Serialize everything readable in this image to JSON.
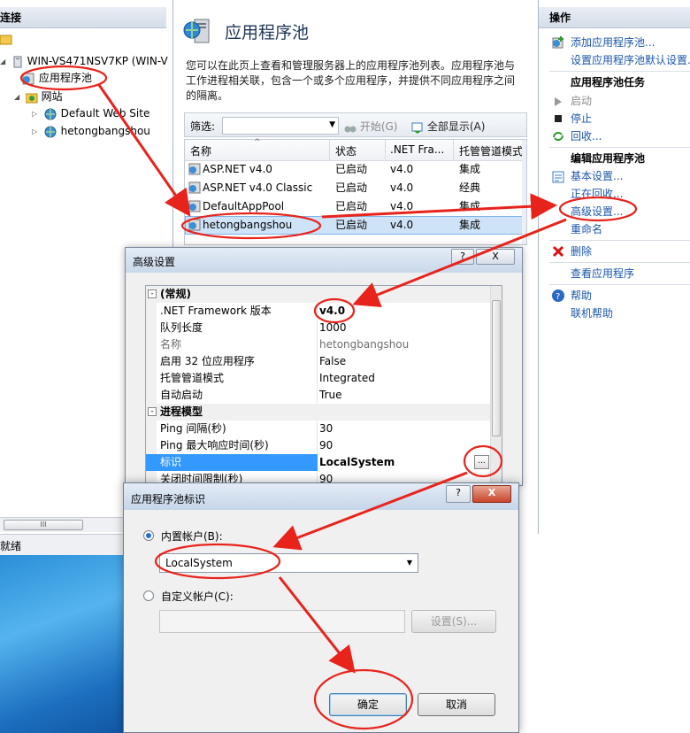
{
  "connections": {
    "header": "连接",
    "server": "WIN-VS471NSV7KP (WIN-V",
    "app_pools": "应用程序池",
    "sites": "网站",
    "site1": "Default Web Site",
    "site2": "hetongbangshou",
    "scroll_grip": "III",
    "status": "就绪"
  },
  "features": {
    "title": "应用程序池",
    "description": "您可以在此页上查看和管理服务器上的应用程序池列表。应用程序池与工作进程相关联，包含一个或多个应用程序，并提供不同应用程序之间的隔离。",
    "filter_label": "筛选:",
    "start_label": "开始(G)",
    "show_all_label": "全部显示(A)",
    "columns": [
      "名称",
      "状态",
      ".NET Fra...",
      "托管管道模式"
    ],
    "rows": [
      {
        "name": "ASP.NET v4.0",
        "status": "已启动",
        "net": "v4.0",
        "mode": "集成"
      },
      {
        "name": "ASP.NET v4.0 Classic",
        "status": "已启动",
        "net": "v4.0",
        "mode": "经典"
      },
      {
        "name": "DefaultAppPool",
        "status": "已启动",
        "net": "v4.0",
        "mode": "集成"
      },
      {
        "name": "hetongbangshou",
        "status": "已启动",
        "net": "v4.0",
        "mode": "集成"
      }
    ]
  },
  "actions": {
    "header": "操作",
    "add_pool": "添加应用程序池...",
    "set_defaults": "设置应用程序池默认设置...",
    "tasks_header": "应用程序池任务",
    "start": "启动",
    "stop": "停止",
    "recycle": "回收...",
    "edit_header": "编辑应用程序池",
    "basic_settings": "基本设置...",
    "recycling": "正在回收...",
    "advanced_settings": "高级设置...",
    "rename": "重命名",
    "delete": "删除",
    "view_apps": "查看应用程序",
    "help": "帮助",
    "online_help": "联机帮助"
  },
  "advanced_dialog": {
    "title": "高级设置",
    "help_btn": "?",
    "close_btn": "X",
    "properties": [
      {
        "name": "(常规)",
        "value": ""
      },
      {
        "name": ".NET Framework 版本",
        "value": "v4.0"
      },
      {
        "name": "队列长度",
        "value": "1000"
      },
      {
        "name": "名称",
        "value": "hetongbangshou"
      },
      {
        "name": "启用 32 位应用程序",
        "value": "False"
      },
      {
        "name": "托管管道模式",
        "value": "Integrated"
      },
      {
        "name": "自动启动",
        "value": "True"
      },
      {
        "name": "进程模型",
        "value": ""
      },
      {
        "name": "Ping 间隔(秒)",
        "value": "30"
      },
      {
        "name": "Ping 最大响应时间(秒)",
        "value": "90"
      },
      {
        "name": "标识",
        "value": "LocalSystem"
      },
      {
        "name": "关闭时间限制(秒)",
        "value": "90"
      }
    ],
    "ellipsis": "..."
  },
  "identity_dialog": {
    "title": "应用程序池标识",
    "help_btn": "?",
    "close_btn": "X",
    "builtin_label": "内置帐户(B):",
    "builtin_value": "LocalSystem",
    "custom_label": "自定义帐户(C):",
    "set_button": "设置(S)...",
    "ok_button": "确定",
    "cancel_button": "取消"
  }
}
